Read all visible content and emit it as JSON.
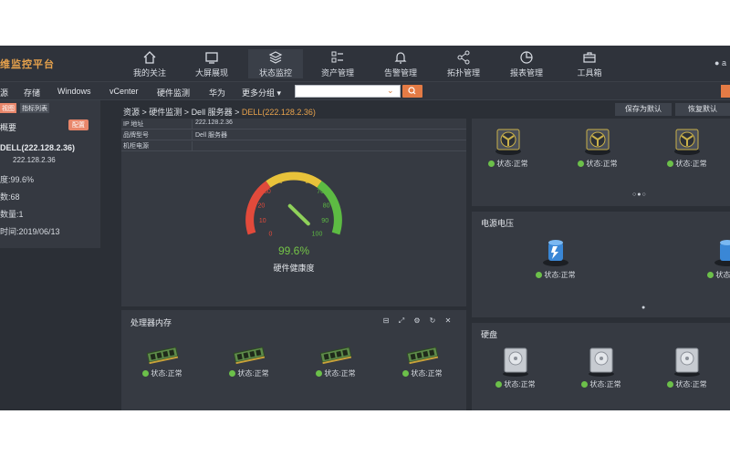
{
  "header": {
    "brand": "维监控平台",
    "nav": [
      {
        "label": "我的关注",
        "icon": "home-icon"
      },
      {
        "label": "大屏展现",
        "icon": "screen-icon"
      },
      {
        "label": "状态监控",
        "icon": "layers-icon"
      },
      {
        "label": "资产管理",
        "icon": "list-icon"
      },
      {
        "label": "告警管理",
        "icon": "bell-icon"
      },
      {
        "label": "拓扑管理",
        "icon": "topology-icon"
      },
      {
        "label": "报表管理",
        "icon": "pie-chart-icon"
      },
      {
        "label": "工具箱",
        "icon": "toolbox-icon"
      }
    ],
    "user_label": "a"
  },
  "subbar": {
    "items": [
      "源",
      "存储",
      "Windows",
      "vCenter",
      "硬件监测",
      "华为",
      "更多分组 ▾"
    ],
    "search_placeholder": ""
  },
  "left": {
    "tabs": [
      "视图",
      "指标列表"
    ],
    "title": "概要",
    "config_label": "配置",
    "device_name": "DELL(222.128.2.36)",
    "device_ip": "222.128.2.36",
    "health": "度:99.6%",
    "count": "数:68",
    "item_count": "数量:1",
    "time": "时间:2019/06/13"
  },
  "breadcrumb": {
    "parts": [
      "资源",
      "硬件监测",
      "Dell 服务器"
    ],
    "current": "DELL(222.128.2.36)",
    "save_label": "保存为默认",
    "restore_label": "恢复默认"
  },
  "info_table": [
    {
      "key": "IP 地址",
      "value": "222.128.2.36"
    },
    {
      "key": "品牌型号",
      "value": "Dell 服务器"
    },
    {
      "key": "机柜电源",
      "value": ""
    }
  ],
  "gauge": {
    "value_text": "99.6%",
    "value": 99.6,
    "label": "硬件健康度",
    "ticks": [
      "0",
      "10",
      "20",
      "30",
      "40",
      "50",
      "60",
      "70",
      "80",
      "90",
      "100"
    ]
  },
  "memory": {
    "title": "处理器内存",
    "status": "状态:正常",
    "count": 4
  },
  "fans": {
    "status": "状态:正常",
    "count": 3,
    "pager": "○●○"
  },
  "psu": {
    "title": "电源电压",
    "status": "状态:正常",
    "pager": "●"
  },
  "disks": {
    "title": "硬盘",
    "status": "状态:正常"
  },
  "colors": {
    "accent": "#e7a24c",
    "ok": "#6cc04a",
    "button": "#e47b45",
    "background": "#2b2f36"
  }
}
